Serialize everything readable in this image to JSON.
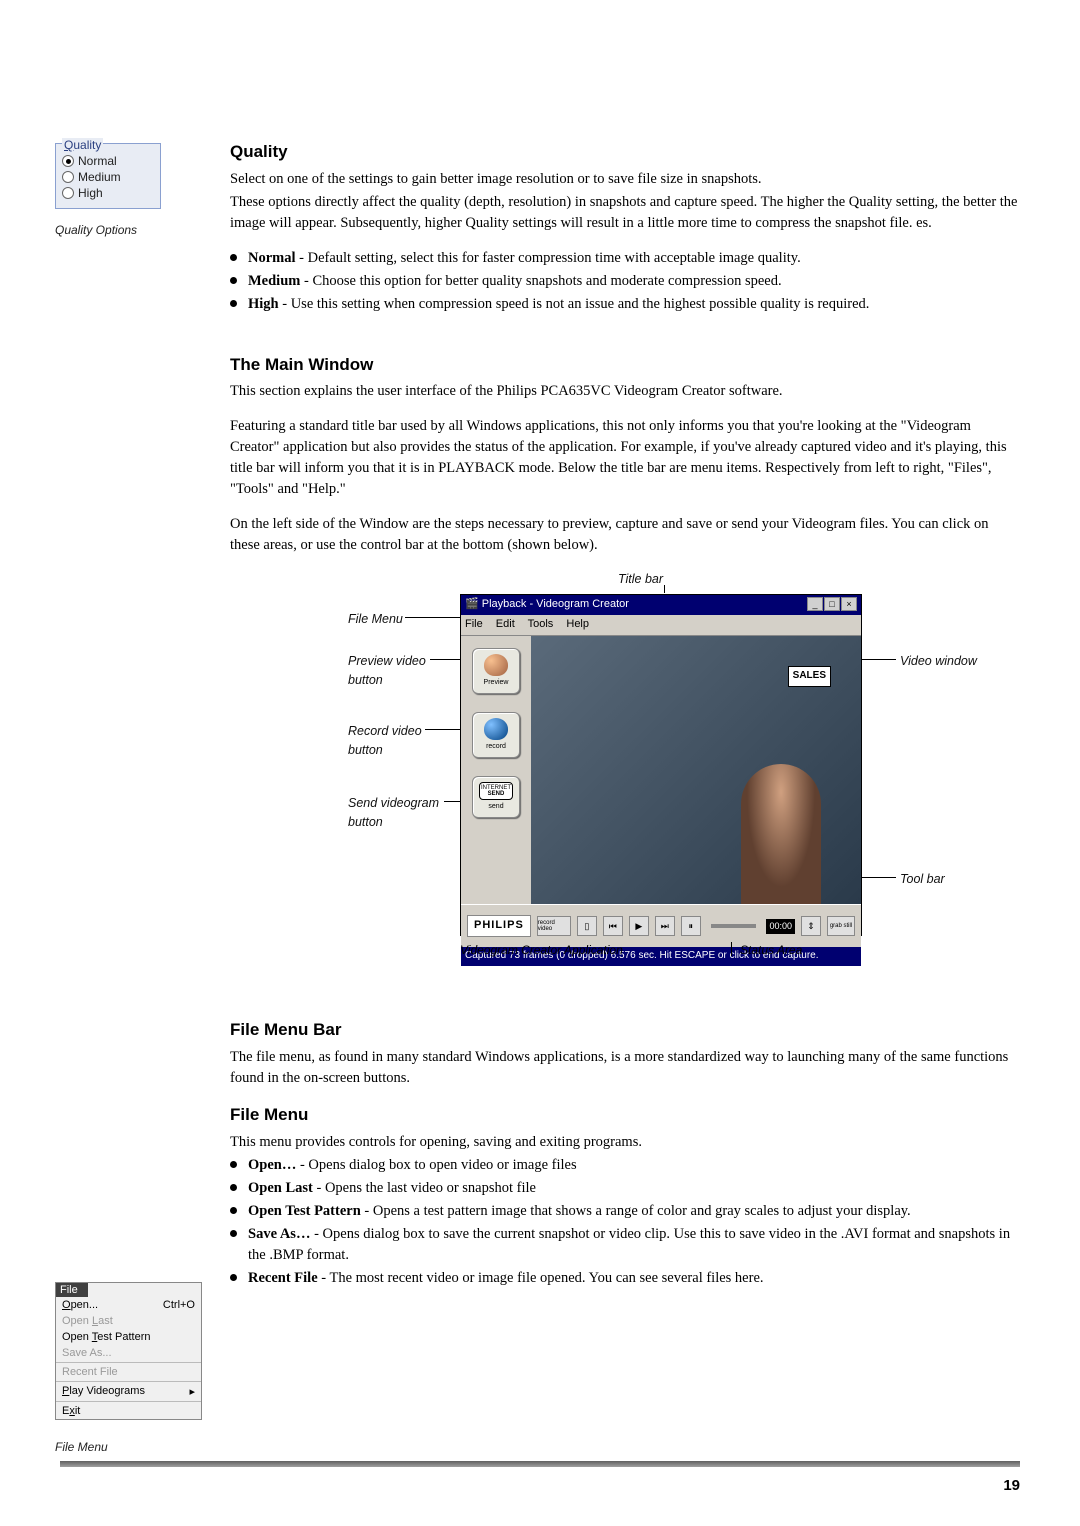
{
  "quality_panel": {
    "legend": "Quality",
    "opts": {
      "normal": "Normal",
      "medium": "Medium",
      "high": "High"
    },
    "caption": "Quality Options"
  },
  "section_quality": {
    "heading": "Quality",
    "p1": "Select on one of the settings to gain better image resolution or to save file size in snapshots.",
    "p2": "These options directly affect the quality (depth, resolution) in snapshots and capture speed. The higher the Quality setting, the better the image will appear. Subsequently, higher Quality settings will result in a little more time to compress the snapshot file. es.",
    "bullets": [
      {
        "term": "Normal",
        "desc": " - Default setting, select this for faster compression time with acceptable image quality."
      },
      {
        "term": "Medium",
        "desc": " - Choose this option for better quality snapshots and moderate compression speed."
      },
      {
        "term": "High",
        "desc": " - Use this setting when compression speed is not an issue and the highest possible quality is required."
      }
    ]
  },
  "section_mainwin": {
    "heading": "The Main Window",
    "p1": "This section explains the user interface of the Philips PCA635VC Videogram Creator software.",
    "p2": "Featuring a standard title bar used by all Windows applications, this not only informs you that you're looking at the \"Videogram Creator\" application but also provides the status of the application. For example, if you've already captured video and it's playing, this title bar will inform you that it is in PLAYBACK mode. Below the title bar are menu items. Respectively from left to right, \"Files\", \"Tools\" and \"Help.\"",
    "p3": "On the left side of the Window are the steps necessary to preview, capture and save or send your Videogram files. You can click on these areas, or use the control bar at the bottom (shown below)."
  },
  "vg_labels": {
    "title_bar": "Title bar",
    "file_menu": "File Menu",
    "preview": "Preview video button",
    "record": "Record video button",
    "send": "Send videogram button",
    "video_window": "Video window",
    "tool_bar": "Tool bar",
    "caption_app": "Videogram Creator Application",
    "caption_status": "Status Area"
  },
  "vg_app": {
    "title": "Playback - Videogram Creator",
    "menus": {
      "file": "File",
      "edit": "Edit",
      "tools": "Tools",
      "help": "Help"
    },
    "side": {
      "preview": "Preview",
      "record": "record",
      "send_top": "INTERNET",
      "send_bottom": "SEND",
      "send_lbl": "send"
    },
    "sales": "SALES",
    "philips": "PHILIPS",
    "tool_rec": "record video",
    "timer": "00:00",
    "grab": "grab still",
    "status": "Captured 73 frames (0 dropped) 6.576 sec. Hit ESCAPE or click to end capture."
  },
  "section_filemenu_bar": {
    "heading": "File Menu Bar",
    "p1": "The file menu, as found in many standard Windows applications, is a more standardized way to launching many of the same functions found in the on-screen buttons."
  },
  "section_filemenu": {
    "heading": "File Menu",
    "p1": "This menu provides controls for opening, saving and exiting programs.",
    "bullets": [
      {
        "term": "Open…",
        "desc": " - Opens dialog box to open video or image files"
      },
      {
        "term": "Open Last",
        "desc": " - Opens the last video or snapshot file"
      },
      {
        "term": "Open Test Pattern",
        "desc": " - Opens a test pattern image that shows a range of color and gray scales to adjust your display."
      },
      {
        "term": "Save As…",
        "desc": " - Opens dialog box to save the current snapshot or video clip. Use this to save video in the .AVI format and snapshots in the .BMP format."
      },
      {
        "term": "Recent File",
        "desc": " - The most recent video or image file opened. You can see several files here."
      }
    ]
  },
  "fm_fig": {
    "title": "File",
    "items": {
      "open": "Open...",
      "open_sc": "Ctrl+O",
      "open_last": "Open Last",
      "open_test": "Open Test Pattern",
      "save_as": "Save As...",
      "recent": "Recent File",
      "play": "Play Videograms",
      "exit": "Exit"
    },
    "caption": "File Menu"
  },
  "page_number": "19"
}
